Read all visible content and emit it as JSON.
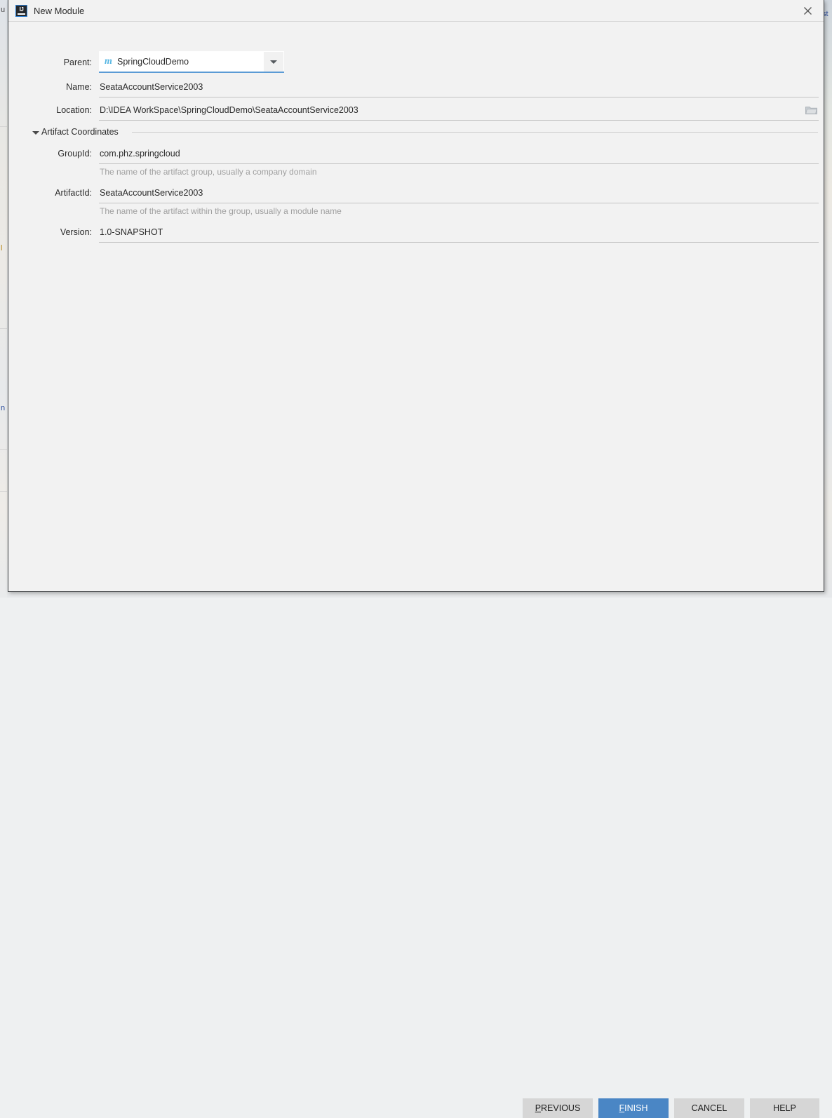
{
  "background": {
    "fragments": [
      {
        "id": "u",
        "text": "u"
      },
      {
        "id": "l",
        "text": "l"
      },
      {
        "id": "n",
        "text": "n"
      },
      {
        "id": "st",
        "text": "st"
      }
    ]
  },
  "dialog": {
    "title": "New Module",
    "app_icon": "intellij-idea-icon",
    "app_icon_letters": "IJ",
    "close_icon": "close-icon",
    "accent_color": "#4a86c5",
    "focus_underline_color": "#5b9bd5"
  },
  "form": {
    "parent": {
      "label": "Parent:",
      "value": "SpringCloudDemo",
      "icon": "maven-module-icon",
      "icon_glyph": "m",
      "icon_color": "#58b7e3",
      "dropdown_icon": "chevron-down-icon"
    },
    "name": {
      "label": "Name:",
      "value": "SeataAccountService2003"
    },
    "location": {
      "label": "Location:",
      "value": "D:\\IDEA WorkSpace\\SpringCloudDemo\\SeataAccountService2003",
      "browse_icon": "folder-icon"
    },
    "artifact_coordinates": {
      "label": "Artifact Coordinates",
      "expanded": true,
      "toggle_icon": "triangle-down-icon",
      "group_id": {
        "label": "GroupId:",
        "value": "com.phz.springcloud",
        "hint": "The name of the artifact group, usually a company domain"
      },
      "artifact_id": {
        "label": "ArtifactId:",
        "value": "SeataAccountService2003",
        "hint": "The name of the artifact within the group, usually a module name"
      },
      "version": {
        "label": "Version:",
        "value": "1.0-SNAPSHOT"
      }
    }
  },
  "footer": {
    "previous": {
      "mnemonic": "P",
      "rest": "REVIOUS"
    },
    "finish": {
      "mnemonic": "F",
      "rest": "INISH"
    },
    "cancel": {
      "label": "CANCEL"
    },
    "help": {
      "label": "HELP"
    }
  }
}
